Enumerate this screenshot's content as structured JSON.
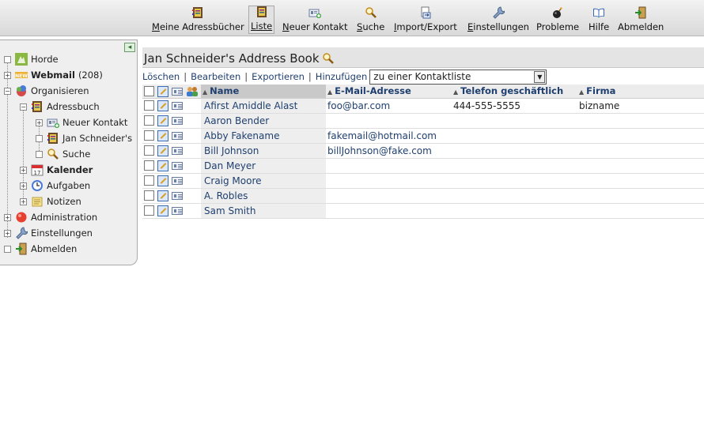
{
  "toolbar": {
    "items": [
      {
        "label_pre": "",
        "label_ul": "M",
        "label_post": "eine Adressbücher",
        "icon": "address-book-icon"
      },
      {
        "label_pre": "",
        "label_ul": "L",
        "label_post": "iste",
        "icon": "list-icon",
        "active": true
      },
      {
        "label_pre": "",
        "label_ul": "N",
        "label_post": "euer Kontakt",
        "icon": "new-contact-icon"
      },
      {
        "label_pre": "",
        "label_ul": "S",
        "label_post": "uche",
        "icon": "search-icon"
      },
      {
        "label_pre": "",
        "label_ul": "I",
        "label_post": "mport/Export",
        "icon": "import-export-icon"
      },
      {
        "label_pre": "",
        "label_ul": "E",
        "label_post": "instellungen",
        "icon": "wrench-icon"
      },
      {
        "label_pre": "",
        "label_ul": "",
        "label_post": "Probleme",
        "icon": "bomb-icon"
      },
      {
        "label_pre": "",
        "label_ul": "",
        "label_post": "Hilfe",
        "icon": "help-book-icon"
      },
      {
        "label_pre": "",
        "label_ul": "",
        "label_post": "Abmelden",
        "icon": "logout-icon"
      }
    ]
  },
  "sidebar": {
    "collapse_glyph": "◂",
    "tree": [
      {
        "label": "Horde",
        "bold": false,
        "toggle": "",
        "icon": "horde-icon"
      },
      {
        "label": "Webmail",
        "count": "(208)",
        "bold": true,
        "toggle": "+",
        "icon": "new-mail-icon"
      },
      {
        "label": "Organisieren",
        "bold": false,
        "toggle": "−",
        "icon": "organize-icon"
      },
      {
        "label": "Adressbuch",
        "bold": false,
        "toggle": "−",
        "icon": "address-book-icon"
      },
      {
        "label": "Neuer Kontakt",
        "bold": false,
        "toggle": "+",
        "icon": "new-contact-icon"
      },
      {
        "label": "Jan Schneider's",
        "bold": false,
        "toggle": "",
        "icon": "address-book-icon"
      },
      {
        "label": "Suche",
        "bold": false,
        "toggle": "",
        "icon": "search-icon"
      },
      {
        "label": "Kalender",
        "bold": true,
        "toggle": "+",
        "icon": "calendar-icon"
      },
      {
        "label": "Aufgaben",
        "bold": false,
        "toggle": "+",
        "icon": "tasks-icon"
      },
      {
        "label": "Notizen",
        "bold": false,
        "toggle": "+",
        "icon": "notes-icon"
      },
      {
        "label": "Administration",
        "bold": false,
        "toggle": "+",
        "icon": "administration-icon"
      },
      {
        "label": "Einstellungen",
        "bold": false,
        "toggle": "+",
        "icon": "wrench-icon"
      },
      {
        "label": "Abmelden",
        "bold": false,
        "toggle": "",
        "icon": "logout-icon"
      }
    ]
  },
  "main": {
    "title": "Jan Schneider's Address Book",
    "actions": {
      "delete": "Löschen",
      "edit": "Bearbeiten",
      "export": "Exportieren",
      "add": "Hinzufügen",
      "contactlist_select": "zu einer Kontaktliste"
    },
    "columns": {
      "name": "Name",
      "email": "E-Mail-Adresse",
      "phone": "Telefon geschäftlich",
      "company": "Firma"
    },
    "rows": [
      {
        "name": "Afirst Amiddle Alast",
        "email": "foo@bar.com",
        "phone": "444-555-5555",
        "company": "bizname"
      },
      {
        "name": "Aaron Bender",
        "email": "",
        "phone": "",
        "company": ""
      },
      {
        "name": "Abby Fakename",
        "email": "fakemail@hotmail.com",
        "phone": "",
        "company": ""
      },
      {
        "name": "Bill Johnson",
        "email": "billJohnson@fake.com",
        "phone": "",
        "company": ""
      },
      {
        "name": "Dan Meyer",
        "email": "",
        "phone": "",
        "company": ""
      },
      {
        "name": "Craig Moore",
        "email": "",
        "phone": "",
        "company": ""
      },
      {
        "name": "A. Robles",
        "email": "",
        "phone": "",
        "company": ""
      },
      {
        "name": "Sam Smith",
        "email": "",
        "phone": "",
        "company": ""
      }
    ]
  },
  "colors": {
    "link": "#1f3f6f",
    "toolbar_bg": "#e0e0e0",
    "sidebar_bg": "#efefef",
    "title_bar_bg": "#e4e4e4"
  }
}
